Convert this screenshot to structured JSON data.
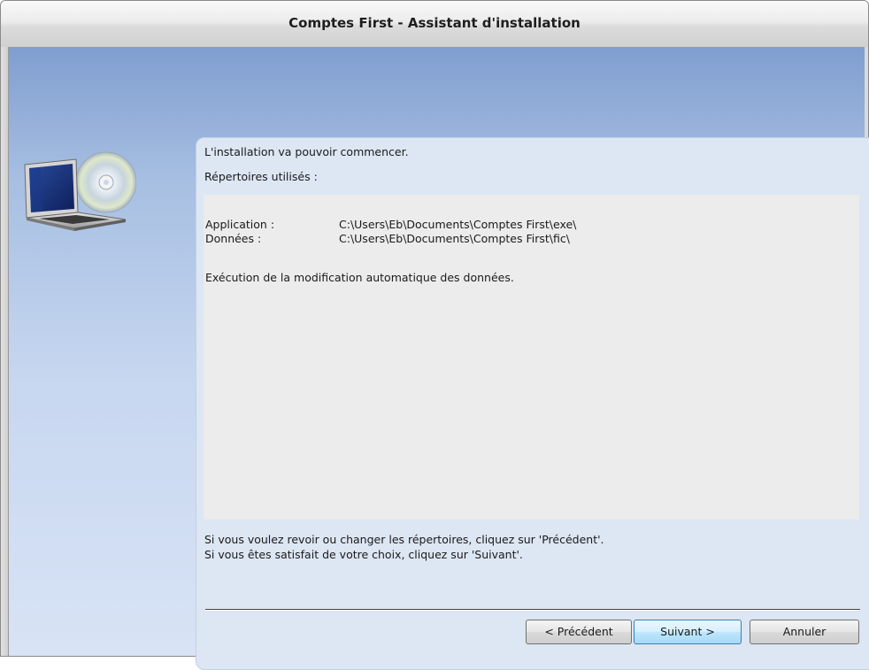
{
  "window": {
    "title": "Comptes First - Assistant d'installation"
  },
  "main": {
    "intro": "L'installation va pouvoir commencer.",
    "directories_label": "Répertoires utilisés :",
    "directories": [
      {
        "label": "Application :",
        "path": "C:\\Users\\Eb\\Documents\\Comptes First\\exe\\"
      },
      {
        "label": "Données :",
        "path": "C:\\Users\\Eb\\Documents\\Comptes First\\fic\\"
      }
    ],
    "execution_note": "Exécution de la modification automatique des données.",
    "hint_previous": "Si vous voulez revoir ou changer les répertoires, cliquez sur 'Précédent'.",
    "hint_next": "Si vous êtes satisfait de votre choix, cliquez sur 'Suivant'."
  },
  "buttons": {
    "previous": "< Précédent",
    "next": "Suivant >",
    "cancel": "Annuler"
  },
  "icons": {
    "installer": "laptop-cd-icon"
  },
  "colors": {
    "accent": "#3c7fb1",
    "background_top": "#809ecf",
    "background_bottom": "#d8e3f5"
  }
}
